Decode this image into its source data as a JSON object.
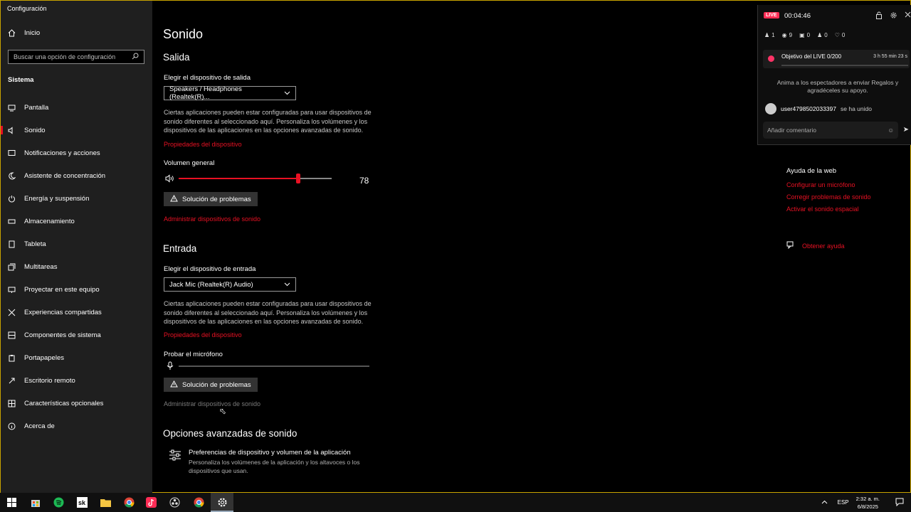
{
  "window": {
    "title": "Configuración"
  },
  "sidebar": {
    "home_label": "Inicio",
    "search_placeholder": "Buscar una opción de configuración",
    "section": "Sistema",
    "items": [
      {
        "label": "Pantalla",
        "icon": "display-icon"
      },
      {
        "label": "Sonido",
        "icon": "speaker-icon",
        "active": true
      },
      {
        "label": "Notificaciones y acciones",
        "icon": "notifications-icon"
      },
      {
        "label": "Asistente de concentración",
        "icon": "moon-icon"
      },
      {
        "label": "Energía y suspensión",
        "icon": "power-icon"
      },
      {
        "label": "Almacenamiento",
        "icon": "storage-icon"
      },
      {
        "label": "Tableta",
        "icon": "tablet-icon"
      },
      {
        "label": "Multitareas",
        "icon": "multitask-icon"
      },
      {
        "label": "Proyectar en este equipo",
        "icon": "project-icon"
      },
      {
        "label": "Experiencias compartidas",
        "icon": "shared-icon"
      },
      {
        "label": "Componentes de sistema",
        "icon": "components-icon"
      },
      {
        "label": "Portapapeles",
        "icon": "clipboard-icon"
      },
      {
        "label": "Escritorio remoto",
        "icon": "remote-icon"
      },
      {
        "label": "Características opcionales",
        "icon": "optional-icon"
      },
      {
        "label": "Acerca de",
        "icon": "info-icon"
      }
    ]
  },
  "main": {
    "title": "Sonido",
    "output": {
      "heading": "Salida",
      "device_label": "Elegir el dispositivo de salida",
      "device_value": "Speakers / Headphones (Realtek(R)...",
      "description": "Ciertas aplicaciones pueden estar configuradas para usar dispositivos de sonido diferentes al seleccionado aquí. Personaliza los volúmenes y los dispositivos de las aplicaciones en las opciones avanzadas de sonido.",
      "properties_link": "Propiedades del dispositivo",
      "volume_label": "Volumen general",
      "volume_value": "78",
      "volume_level": 0.78,
      "troubleshoot": "Solución de problemas",
      "manage_link": "Administrar dispositivos de sonido"
    },
    "input": {
      "heading": "Entrada",
      "device_label": "Elegir el dispositivo de entrada",
      "device_value": "Jack Mic (Realtek(R) Audio)",
      "description": "Ciertas aplicaciones pueden estar configuradas para usar dispositivos de sonido diferentes al seleccionado aquí. Personaliza los volúmenes y los dispositivos de las aplicaciones en las opciones avanzadas de sonido.",
      "properties_link": "Propiedades del dispositivo",
      "mic_label": "Probar el micrófono",
      "troubleshoot": "Solución de problemas",
      "manage_link": "Administrar dispositivos de sonido"
    },
    "advanced": {
      "heading": "Opciones avanzadas de sonido",
      "item_title": "Preferencias de dispositivo y volumen de la aplicación",
      "item_desc": "Personaliza los volúmenes de la aplicación y los altavoces o los dispositivos que usan."
    }
  },
  "help": {
    "title": "Ayuda de la web",
    "links": [
      "Configurar un micrófono",
      "Corregir problemas de sonido",
      "Activar el sonido espacial"
    ],
    "get_help": "Obtener ayuda"
  },
  "live": {
    "badge": "LIVE",
    "time": "00:04:46",
    "stats": [
      "1",
      "9",
      "0",
      "0",
      "0"
    ],
    "goal_text": "Objetivo del LIVE 0/200",
    "goal_time": "3 h 55 min 23 s",
    "hint": "Anima a los espectadores a enviar Regalos y agradéceles su apoyo.",
    "join_user": "user4798502033397",
    "join_text": "se ha unido",
    "comment_placeholder": "Añadir comentario"
  },
  "taskbar": {
    "lang": "ESP",
    "time": "2:32 a. m.",
    "date": "6/8/2025"
  }
}
